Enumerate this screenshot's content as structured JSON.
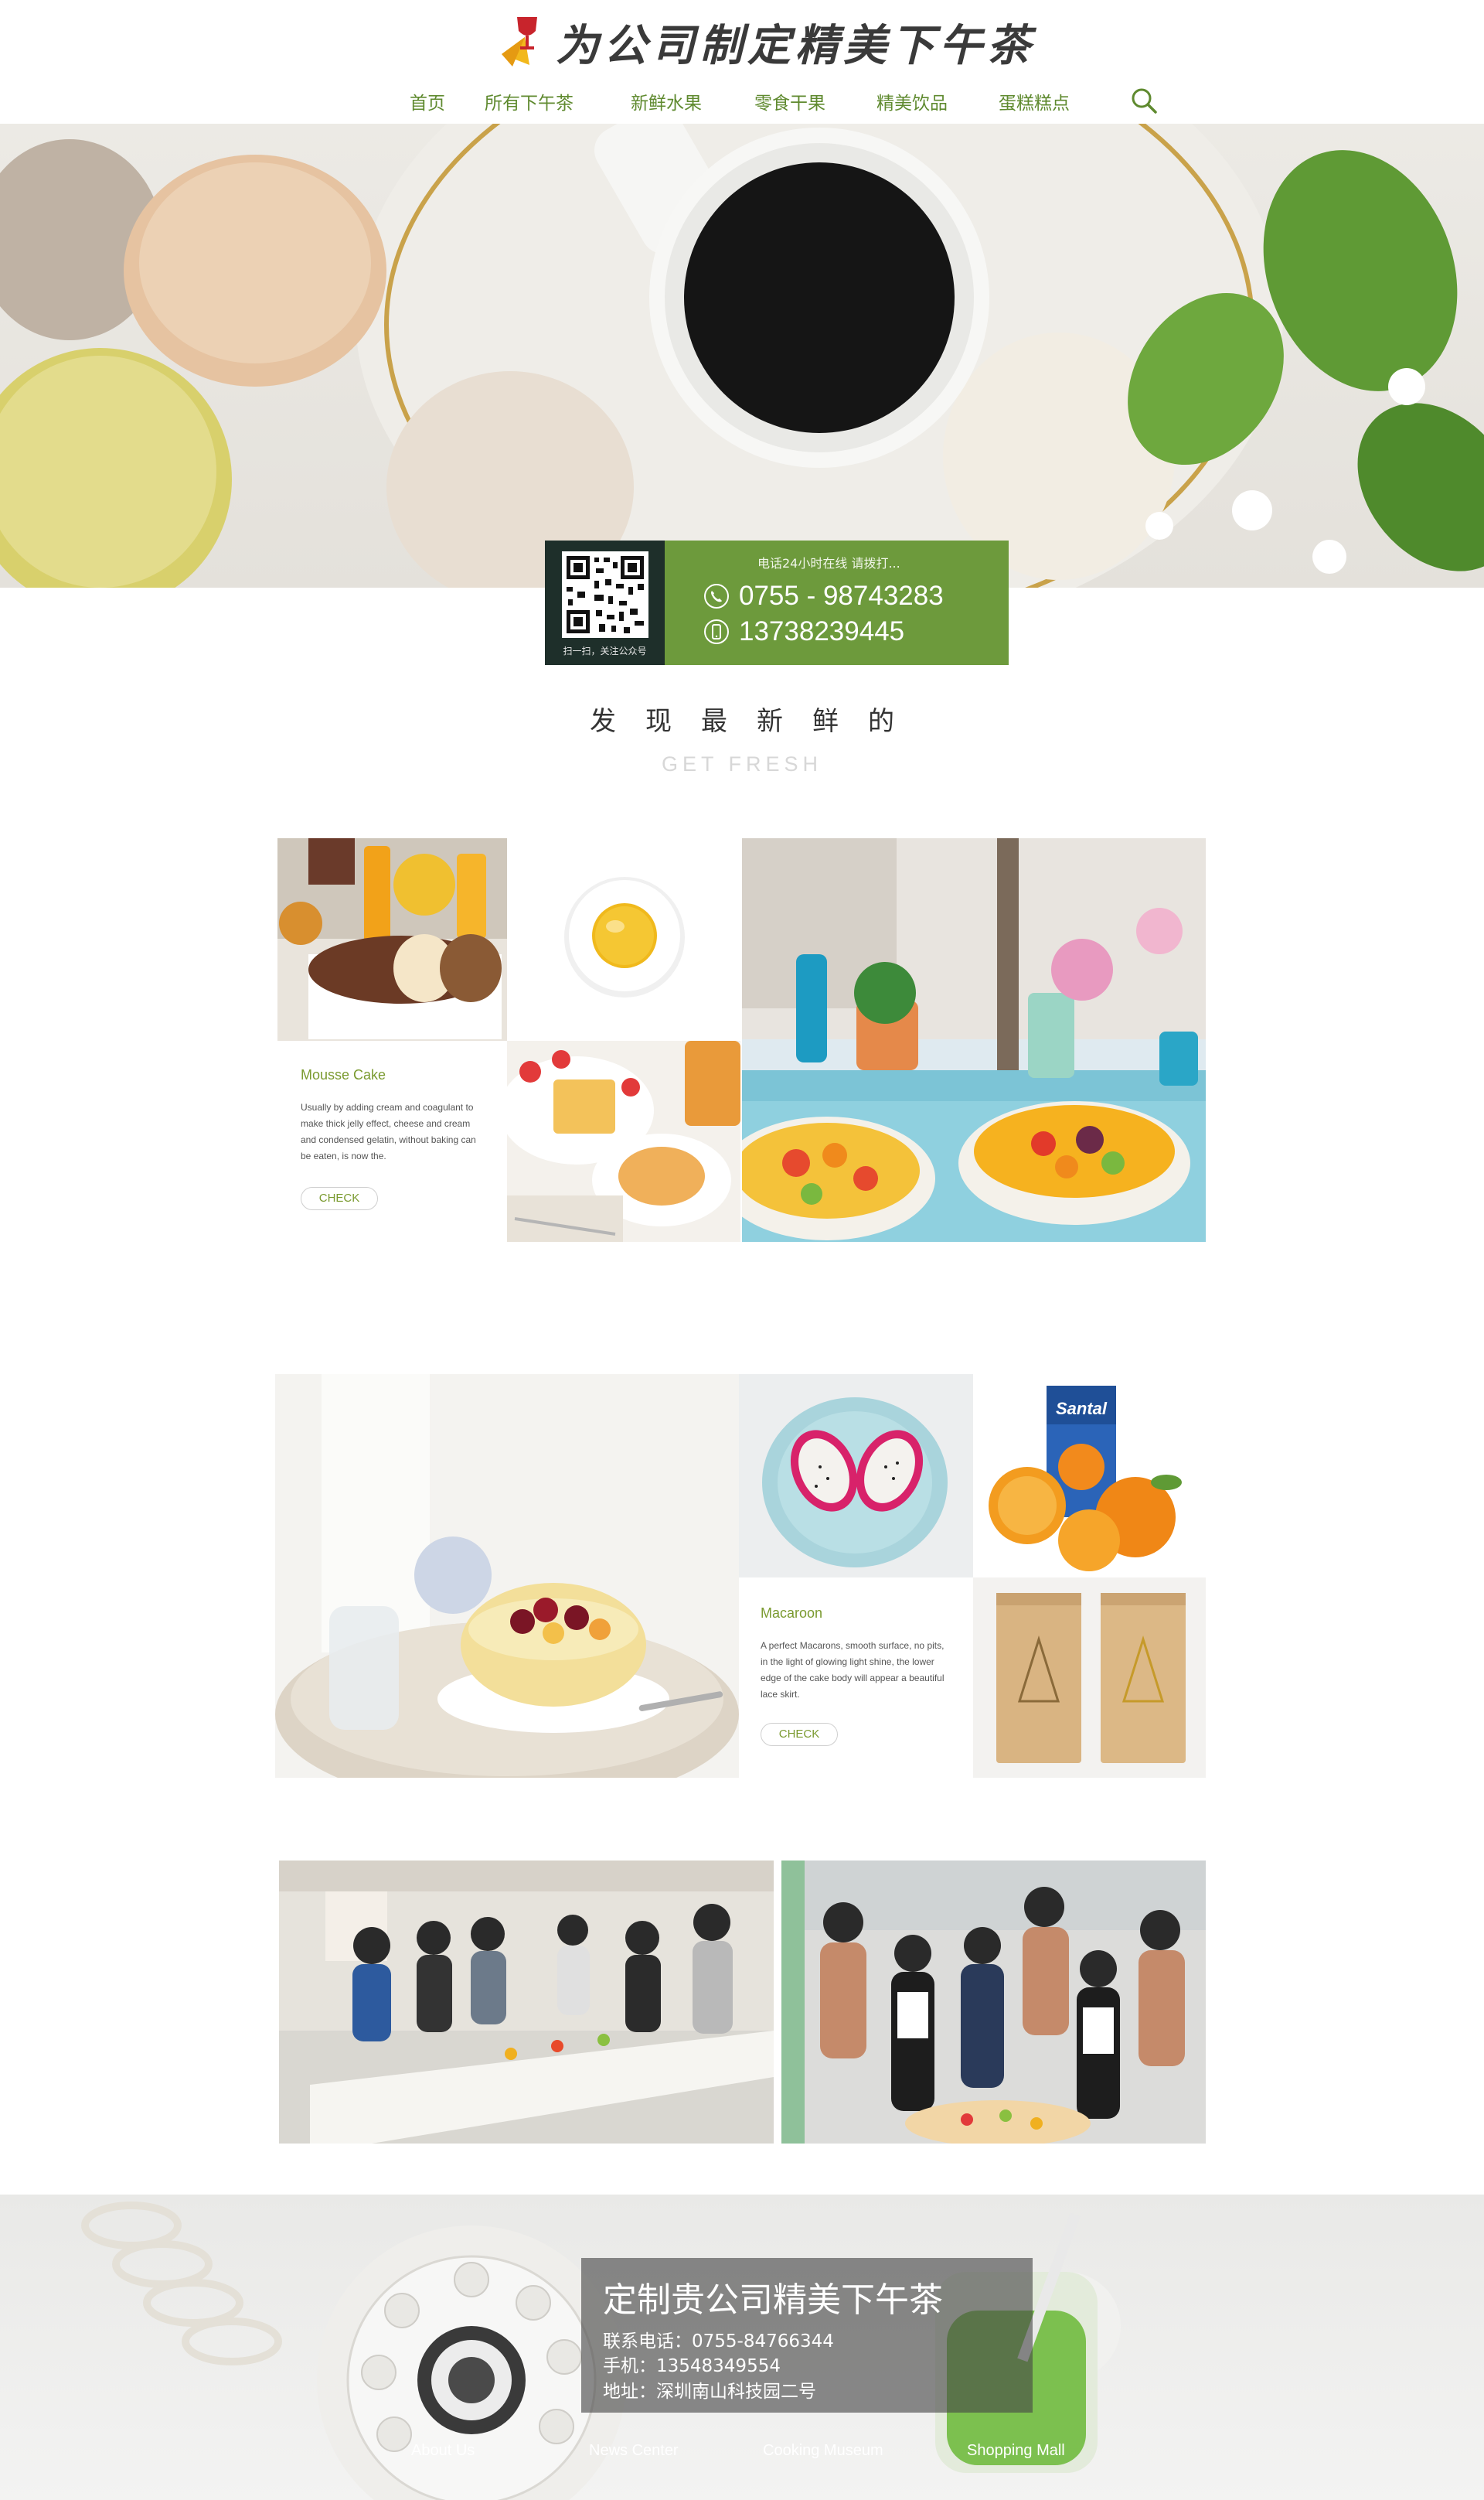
{
  "header": {
    "logo_text": "为公司制定精美下午茶",
    "nav": [
      "首页",
      "所有下午茶",
      "新鲜水果",
      "零食干果",
      "精美饮品",
      "蛋糕糕点"
    ]
  },
  "contact": {
    "qr_caption": "扫一扫，关注公众号",
    "note": "电话24小时在线  请拨打...",
    "phone_1": "0755 - 98743283",
    "phone_2": "13738239445"
  },
  "section": {
    "title": "发现最新鲜的",
    "subtitle": "GET FRESH"
  },
  "cards": {
    "mousse": {
      "title": "Mousse Cake",
      "desc": [
        "Usually by adding cream and coagulant to",
        "make thick jelly effect, cheese and cream",
        "and condensed gelatin, without baking can",
        "be eaten, is now the."
      ],
      "button": "CHECK"
    },
    "macaroon": {
      "title": "Macaroon",
      "desc": [
        "A perfect Macarons, smooth surface, no pits,",
        "in the light of glowing light shine, the lower",
        "edge of the cake body will appear a beautiful",
        "lace skirt."
      ],
      "button": "CHECK"
    }
  },
  "juice_label": "Santal",
  "footer": {
    "title": "定制贵公司精美下午茶",
    "phone": "联系电话：0755-84766344",
    "mobile": "手机：13548349554",
    "address": "地址：深圳南山科技园二号",
    "nav": [
      "About Us",
      "News Center",
      "Cooking Museum",
      "Shopping Mall"
    ]
  },
  "colors": {
    "brand_green": "#6d9a3c",
    "nav_green": "#5f8a2f",
    "qr_dark": "#1e2f2a"
  }
}
